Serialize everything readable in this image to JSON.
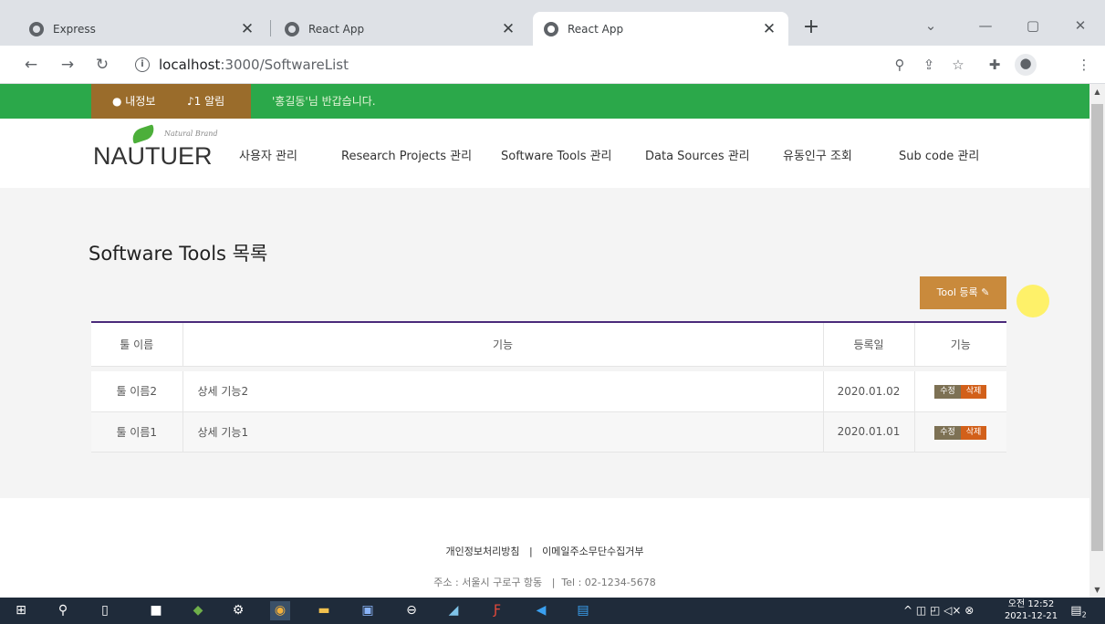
{
  "browser": {
    "tabs": [
      {
        "title": "Express",
        "active": false
      },
      {
        "title": "React App",
        "active": false
      },
      {
        "title": "React App",
        "active": true
      }
    ],
    "new_tab": "+",
    "window_controls": {
      "list": "⌄",
      "minimize": "—",
      "maximize": "▢",
      "close": "✕"
    },
    "url_host": "localhost",
    "url_path": ":3000/SoftwareList"
  },
  "topbar": {
    "my_info": "내정보",
    "alarm": "1 알림",
    "welcome": "'홍길동'님 반갑습니다."
  },
  "header": {
    "brand_small": "Natural Brand",
    "brand": "NAUTUER",
    "menu": [
      "사용자 관리",
      "Research Projects 관리",
      "Software Tools 관리",
      "Data Sources 관리",
      "유동인구 조회",
      "Sub code 관리"
    ]
  },
  "main": {
    "title": "Software Tools 목록",
    "register_button": "Tool 등록",
    "table": {
      "headers": [
        "툴 이름",
        "기능",
        "등록일",
        "기능"
      ],
      "rows": [
        {
          "name": "툴 이름2",
          "desc": "상세 기능2",
          "date": "2020.01.02",
          "edit": "수정",
          "delete": "삭제"
        },
        {
          "name": "툴 이름1",
          "desc": "상세 기능1",
          "date": "2020.01.01",
          "edit": "수정",
          "delete": "삭제"
        }
      ]
    }
  },
  "footer": {
    "privacy": "개인정보처리방침",
    "separator": "|",
    "email": "이메일주소무단수집거부",
    "address": "주소 : 서울시 구로구 항동",
    "tel": "Tel : 02-1234-5678"
  },
  "taskbar": {
    "time": "오전 12:52",
    "date": "2021-12-21",
    "notifications": "2"
  },
  "colors": {
    "topbar_green": "#2ba84a",
    "user_brown": "#9a6c2b",
    "register_button": "#c98a3c",
    "table_top_border": "#4a2a7a",
    "edit_button": "#7d7154",
    "delete_button": "#d2601a"
  }
}
